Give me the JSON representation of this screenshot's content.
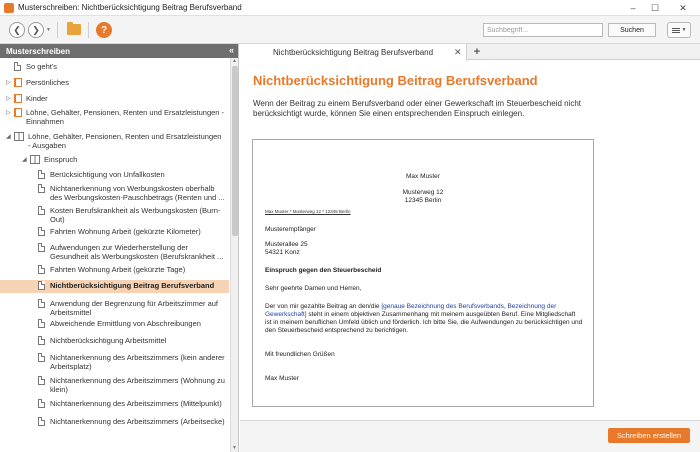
{
  "window": {
    "title": "Musterschreiben: Nichtberücksichtigung Beitrag Berufsverband",
    "buttons": {
      "minimize": "–",
      "maximize": "☐",
      "close": "✕"
    }
  },
  "toolbar": {
    "back_icon": "back-arrow-icon",
    "forward_icon": "forward-arrow-icon",
    "folder_icon": "folder-icon",
    "help_label": "?",
    "search_placeholder": "Suchbegriff...",
    "search_button": "Suchen",
    "menu_icon": "hamburger-menu-icon"
  },
  "sidebar": {
    "title": "Musterschreiben",
    "collapse_label": "«",
    "items": [
      {
        "label": "So geht's",
        "icon": "doc"
      },
      {
        "label": "Persönliches",
        "icon": "book",
        "arrow": "▷"
      },
      {
        "label": "Kinder",
        "icon": "book",
        "arrow": "▷"
      },
      {
        "label": "Löhne, Gehälter, Pensionen, Renten und Ersatzleistungen - Einnahmen",
        "icon": "book",
        "arrow": "▷"
      },
      {
        "label": "Löhne, Gehälter, Pensionen, Renten und Ersatzleistungen - Ausgaben",
        "icon": "book-open",
        "arrow": "◢"
      },
      {
        "label": "Einspruch",
        "icon": "book-open",
        "arrow": "◢"
      },
      {
        "label": "Berücksichtigung von Unfallkosten",
        "icon": "doc"
      },
      {
        "label": "Nichtanerkennung von Werbungskosten oberhalb des Werbungskosten-Pauschbetrags (Renten und ...",
        "icon": "doc"
      },
      {
        "label": "Kosten Berufskrankheit als Werbungskosten (Burn-Out)",
        "icon": "doc"
      },
      {
        "label": "Fahrten Wohnung Arbeit (gekürzte Kilometer)",
        "icon": "doc"
      },
      {
        "label": "Aufwendungen zur Wiederherstellung der Gesundheit als Werbungskosten (Berufskrankheit ...",
        "icon": "doc"
      },
      {
        "label": "Fahrten Wohnung Arbeit (gekürzte Tage)",
        "icon": "doc"
      },
      {
        "label": "Nichtberücksichtigung Beitrag Berufsverband",
        "icon": "doc",
        "selected": true
      },
      {
        "label": "Anwendung der Begrenzung für Arbeitszimmer auf Arbeitsmittel",
        "icon": "doc"
      },
      {
        "label": "Abweichende Ermittlung von Abschreibungen",
        "icon": "doc"
      },
      {
        "label": "Nichtberücksichtigung Arbeitsmittel",
        "icon": "doc"
      },
      {
        "label": "Nichtanerkennung des Arbeitszimmers (kein anderer Arbeitsplatz)",
        "icon": "doc"
      },
      {
        "label": "Nichtanerkennung des Arbeitszimmers (Wohnung zu klein)",
        "icon": "doc"
      },
      {
        "label": "Nichtanerkennung des Arbeitszimmers (Mittelpunkt)",
        "icon": "doc"
      },
      {
        "label": "Nichtanerkennung des Arbeitszimmers (Arbeitsecke)",
        "icon": "doc"
      }
    ]
  },
  "tabs": [
    {
      "label": "Nichtberücksichtigung Beitrag Berufsverband",
      "close": "✕"
    }
  ],
  "tab_add_label": "+",
  "main": {
    "title": "Nichtberücksichtigung Beitrag Berufsverband",
    "intro": "Wenn der Beitrag zu einem Berufsverband oder einer Gewerkschaft im Steuerbescheid nicht berücksichtigt wurde, können Sie einen entsprechenden Einspruch einlegen."
  },
  "letter": {
    "sender_name": "Max Muster",
    "sender_street": "Musterweg 12",
    "sender_city": "12345 Berlin",
    "sender_line": "Max Muster * Musterweg 12 * 12345 Berlin",
    "recipient_name": "Musterempfänger",
    "recipient_street": "Musterallee 25",
    "recipient_city": "54321 Konz",
    "subject": "Einspruch gegen den Steuerbescheid",
    "salutation": "Sehr geehrte Damen und Herren,",
    "body_pre": "Der von mir gezahlte Beitrag an den/die ",
    "body_placeholder": "[genaue Bezeichnung des Berufsverbands, Bezeichnung der Gewerkschaft]",
    "body_post": " steht in einem objektiven Zusammenhang mit meinem ausgeübten Beruf. Eine Mitgliedschaft ist in meinem beruflichen Umfeld üblich und förderlich. Ich bitte Sie, die Aufwendungen zu berücksichtigen und den Steuerbescheid entsprechend zu berichtigen.",
    "closing": "Mit freundlichen Grüßen",
    "signature": "Max Muster"
  },
  "footer": {
    "create_button": "Schreiben erstellen"
  },
  "colors": {
    "accent": "#e8792b",
    "selected_bg": "#f6d3b4",
    "sidebar_header": "#6e6e6e",
    "placeholder_text": "#1f3fa0"
  }
}
